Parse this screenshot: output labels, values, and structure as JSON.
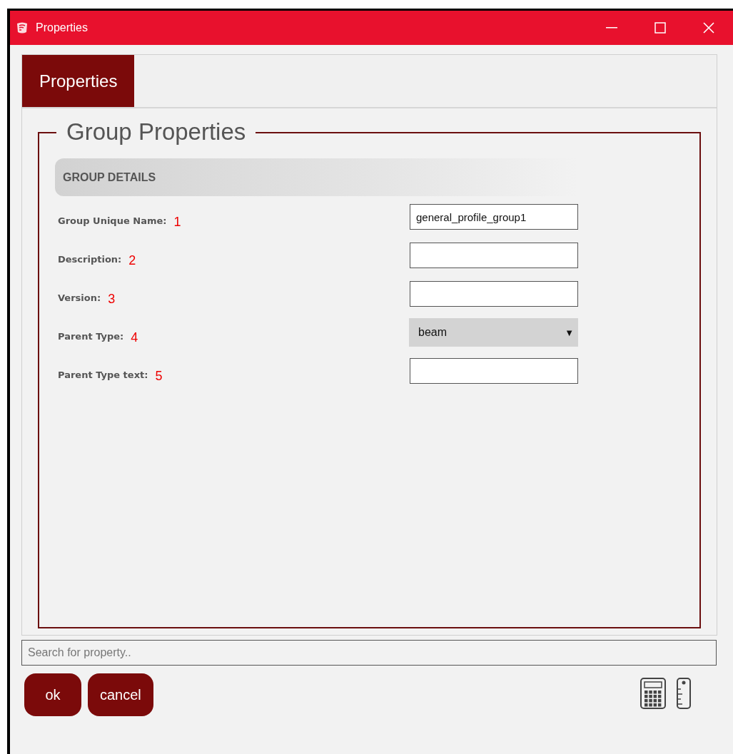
{
  "window": {
    "title": "Properties"
  },
  "tabs": [
    {
      "label": "Properties",
      "selected": true
    }
  ],
  "group": {
    "legend": "Group Properties",
    "section": "GROUP DETAILS",
    "fields": [
      {
        "kind": "text",
        "label": "Group Unique Name:",
        "marker": "1",
        "value": "general_profile_group1"
      },
      {
        "kind": "text",
        "label": "Description:",
        "marker": "2"
      },
      {
        "kind": "text",
        "label": "Version:",
        "marker": "3"
      },
      {
        "kind": "select",
        "label": "Parent Type:",
        "marker": "4",
        "value": "beam",
        "arrow": "▼"
      },
      {
        "kind": "text",
        "label": "Parent Type text:",
        "marker": "5"
      }
    ]
  },
  "search": {
    "placeholder": "Search for property.."
  },
  "buttons": [
    "ok",
    "cancel"
  ]
}
